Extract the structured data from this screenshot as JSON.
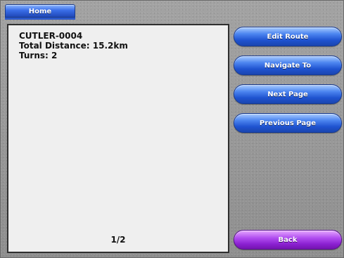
{
  "header": {
    "home_tab_label": "Home"
  },
  "route": {
    "name": "CUTLER-0004",
    "total_distance": "Total Distance: 15.2km",
    "turns": "Turns: 2"
  },
  "pagination": {
    "indicator": "1/2"
  },
  "actions": {
    "edit_route": "Edit Route",
    "navigate_to": "Navigate To",
    "next_page": "Next Page",
    "previous_page": "Previous Page",
    "back": "Back"
  },
  "colors": {
    "button_blue": "#2f64e0",
    "button_purple": "#9a2fe0",
    "background": "#9a9a9a",
    "panel": "#efefef"
  }
}
